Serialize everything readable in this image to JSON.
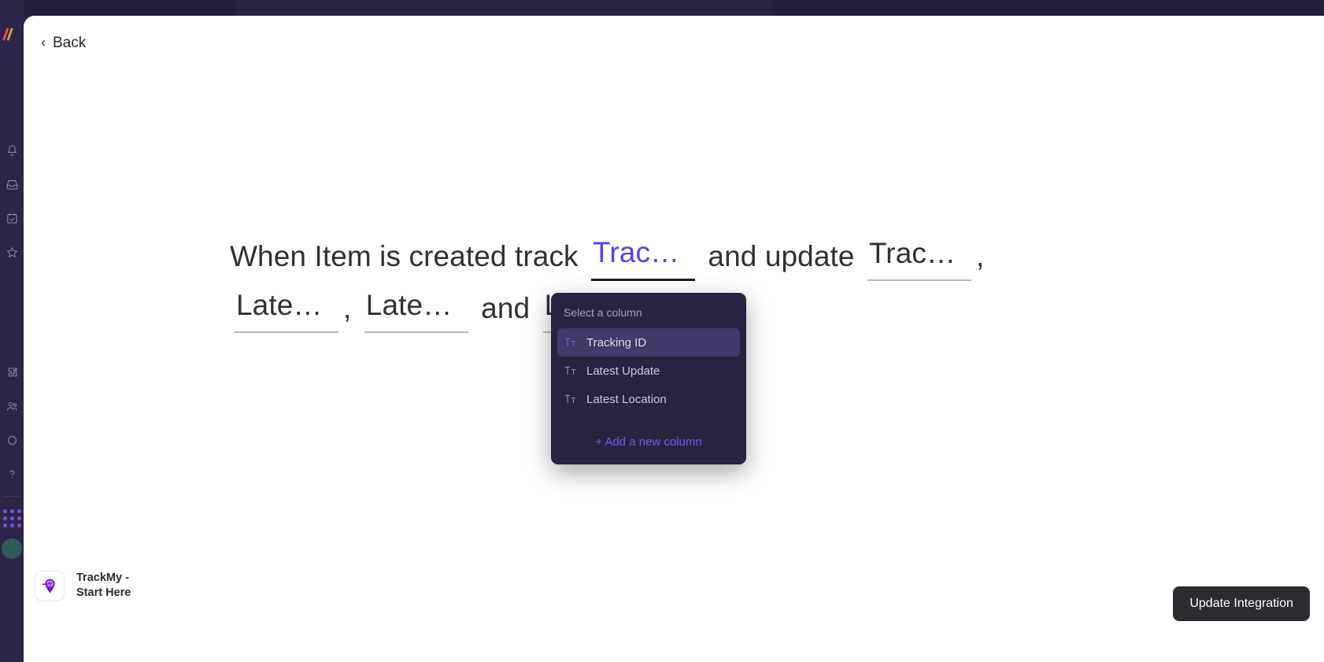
{
  "back": {
    "label": "Back",
    "icon": "chevron-left-icon"
  },
  "rail": {
    "icons": [
      "bell-icon",
      "inbox-icon",
      "calendar-check-icon",
      "star-icon",
      "puzzle-icon",
      "people-icon",
      "circle-icon",
      "question-icon"
    ]
  },
  "recipe": {
    "segments": [
      {
        "type": "text",
        "value": "When Item is created track"
      },
      {
        "type": "field",
        "value": "Trackin…",
        "full": "Tracking ID",
        "state": "active"
      },
      {
        "type": "text",
        "value": "and update"
      },
      {
        "type": "field",
        "value": "Trackin…",
        "full": "Tracking ID",
        "state": "filled"
      },
      {
        "type": "punct",
        "value": ","
      },
      {
        "type": "field",
        "value": "Latest L…",
        "full": "Latest Location",
        "state": "filled"
      },
      {
        "type": "punct",
        "value": ","
      },
      {
        "type": "field",
        "value": "Latest U…",
        "full": "Latest Update",
        "state": "filled"
      },
      {
        "type": "text",
        "value": "and"
      },
      {
        "type": "field",
        "value": "Latest U…",
        "full": "Latest Update",
        "state": "filled"
      },
      {
        "type": "punct",
        "value": "."
      }
    ]
  },
  "dropdown": {
    "title": "Select a column",
    "items": [
      {
        "label": "Tracking ID",
        "icon": "text-type-icon",
        "selected": true
      },
      {
        "label": "Latest Update",
        "icon": "text-type-icon",
        "selected": false
      },
      {
        "label": "Latest Location",
        "icon": "text-type-icon",
        "selected": false
      }
    ],
    "add_label": "+ Add a new column"
  },
  "brand": {
    "name": "TrackMy -\nStart Here",
    "icon": "location-pin-icon"
  },
  "footer": {
    "primary_label": "Update Integration"
  },
  "colors": {
    "accent_purple": "#5b3ef0",
    "link_purple": "#6d56f0",
    "sheet_bg": "#ffffff",
    "app_bg": "#2d2548",
    "dropdown_bg": "#2a2340",
    "dropdown_selected": "#413a6b",
    "button_dark": "#2b2b30"
  }
}
